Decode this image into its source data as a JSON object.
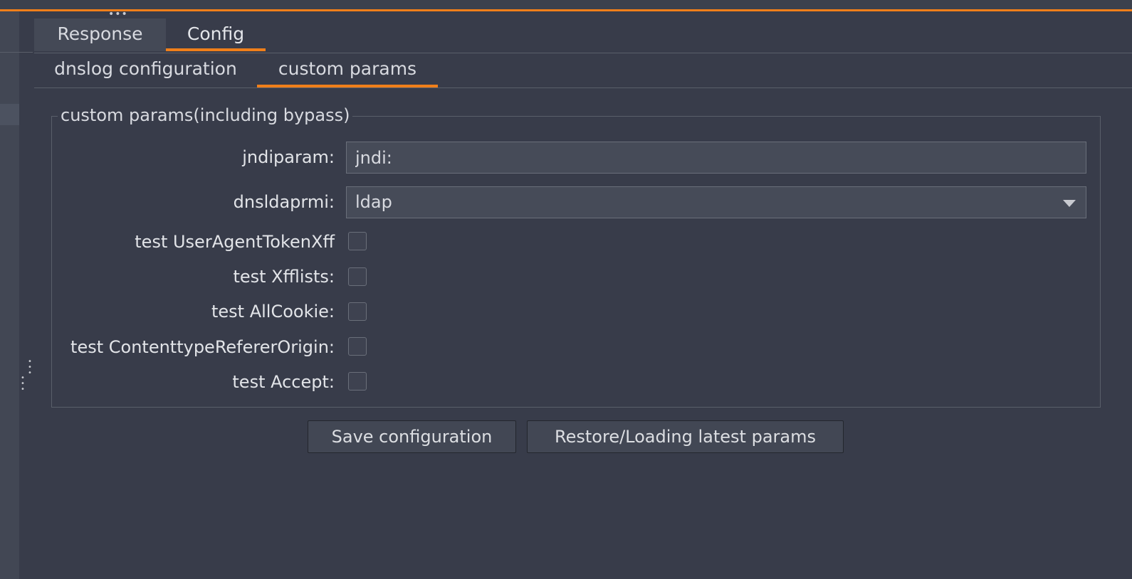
{
  "top_grip": "•••",
  "main_tabs": [
    {
      "label": "Response"
    },
    {
      "label": "Config"
    }
  ],
  "sub_tabs": [
    {
      "label": "dnslog configuration"
    },
    {
      "label": "custom params"
    }
  ],
  "group": {
    "title": "custom params(including bypass)"
  },
  "fields": {
    "jndiparam_label": "jndiparam:",
    "jndiparam_value": "jndi:",
    "dnsldaprmi_label": "dnsldaprmi:",
    "dnsldaprmi_value": "ldap",
    "useragent_label": "test UserAgentTokenXff",
    "xfflists_label": "test Xfflists:",
    "allcookie_label": "test AllCookie:",
    "contenttype_label": "test ContenttypeRefererOrigin:",
    "accept_label": "test Accept:"
  },
  "buttons": {
    "save_label": "Save configuration",
    "restore_label": "Restore/Loading latest params"
  },
  "colors": {
    "accent": "#f07f1a",
    "background": "#383c4a"
  }
}
